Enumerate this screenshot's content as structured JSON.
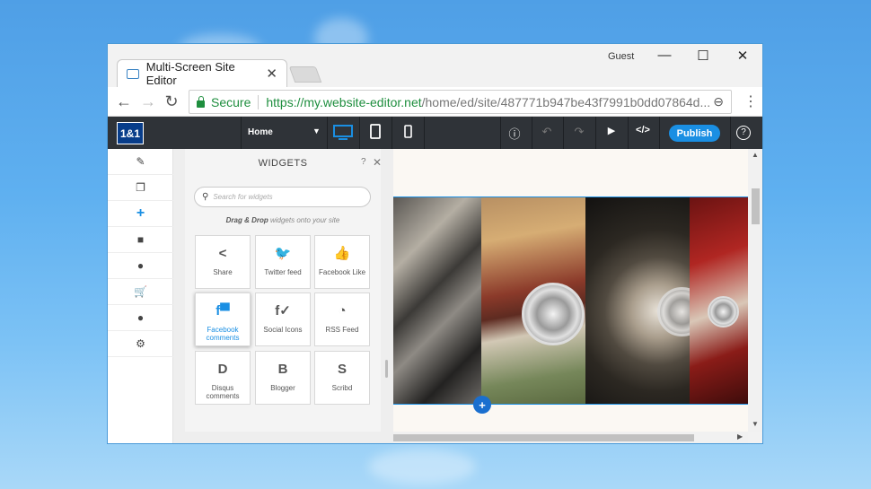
{
  "browser": {
    "tab_title": "Multi-Screen Site Editor",
    "tab_close": "✕",
    "profile": "Guest",
    "win_minimize": "—",
    "win_maximize": "☐",
    "win_close": "✕",
    "back": "←",
    "forward": "→",
    "reload": "↻",
    "secure_label": "Secure",
    "url_scheme_host": "https://my.website-editor.net",
    "url_path": "/home/ed/site/487771b947be43f7991b0dd07864d...",
    "zoom": "⊖",
    "menu": "⋮"
  },
  "toolbar": {
    "logo": "1&1",
    "page_selector": "Home",
    "dropdown_arrow": "▼",
    "info": "ⓘ",
    "undo": "↶",
    "redo": "↷",
    "preview": "▶",
    "code": "</>",
    "publish_label": "Publish",
    "help": "?"
  },
  "rail": {
    "items": [
      {
        "name": "design-icon",
        "glyph": "✎"
      },
      {
        "name": "pages-icon",
        "glyph": "❐"
      },
      {
        "name": "add-widgets-icon",
        "glyph": "+"
      },
      {
        "name": "folder-icon",
        "glyph": "■"
      },
      {
        "name": "user-icon",
        "glyph": "●"
      },
      {
        "name": "cart-icon",
        "glyph": "🛒"
      },
      {
        "name": "comment-icon",
        "glyph": "●"
      },
      {
        "name": "settings-icon",
        "glyph": "⚙"
      }
    ]
  },
  "widgets_panel": {
    "title": "WIDGETS",
    "help": "?",
    "close": "✕",
    "search_placeholder": "Search for widgets",
    "hint_bold": "Drag & Drop",
    "hint_rest": " widgets onto your site",
    "items": [
      {
        "label": "Share",
        "glyph": "<",
        "icon": "share-icon"
      },
      {
        "label": "Twitter feed",
        "glyph": "🐦",
        "icon": "twitter-icon"
      },
      {
        "label": "Facebook Like",
        "glyph": "👍",
        "icon": "thumbs-up-icon"
      },
      {
        "label": "Facebook comments",
        "glyph": "f▀",
        "icon": "facebook-comments-icon"
      },
      {
        "label": "Social Icons",
        "glyph": "f✓",
        "icon": "social-icons-icon"
      },
      {
        "label": "RSS Feed",
        "glyph": "◔",
        "icon": "rss-icon"
      },
      {
        "label": "Disqus comments",
        "glyph": "D",
        "icon": "disqus-icon"
      },
      {
        "label": "Blogger",
        "glyph": "B",
        "icon": "blogger-icon"
      },
      {
        "label": "Scribd",
        "glyph": "S",
        "icon": "scribd-icon"
      }
    ]
  },
  "canvas": {
    "add_section": "+"
  },
  "colors": {
    "accent": "#1a8fe3",
    "toolbar": "#2f3338",
    "secure_green": "#1e8e3e"
  }
}
